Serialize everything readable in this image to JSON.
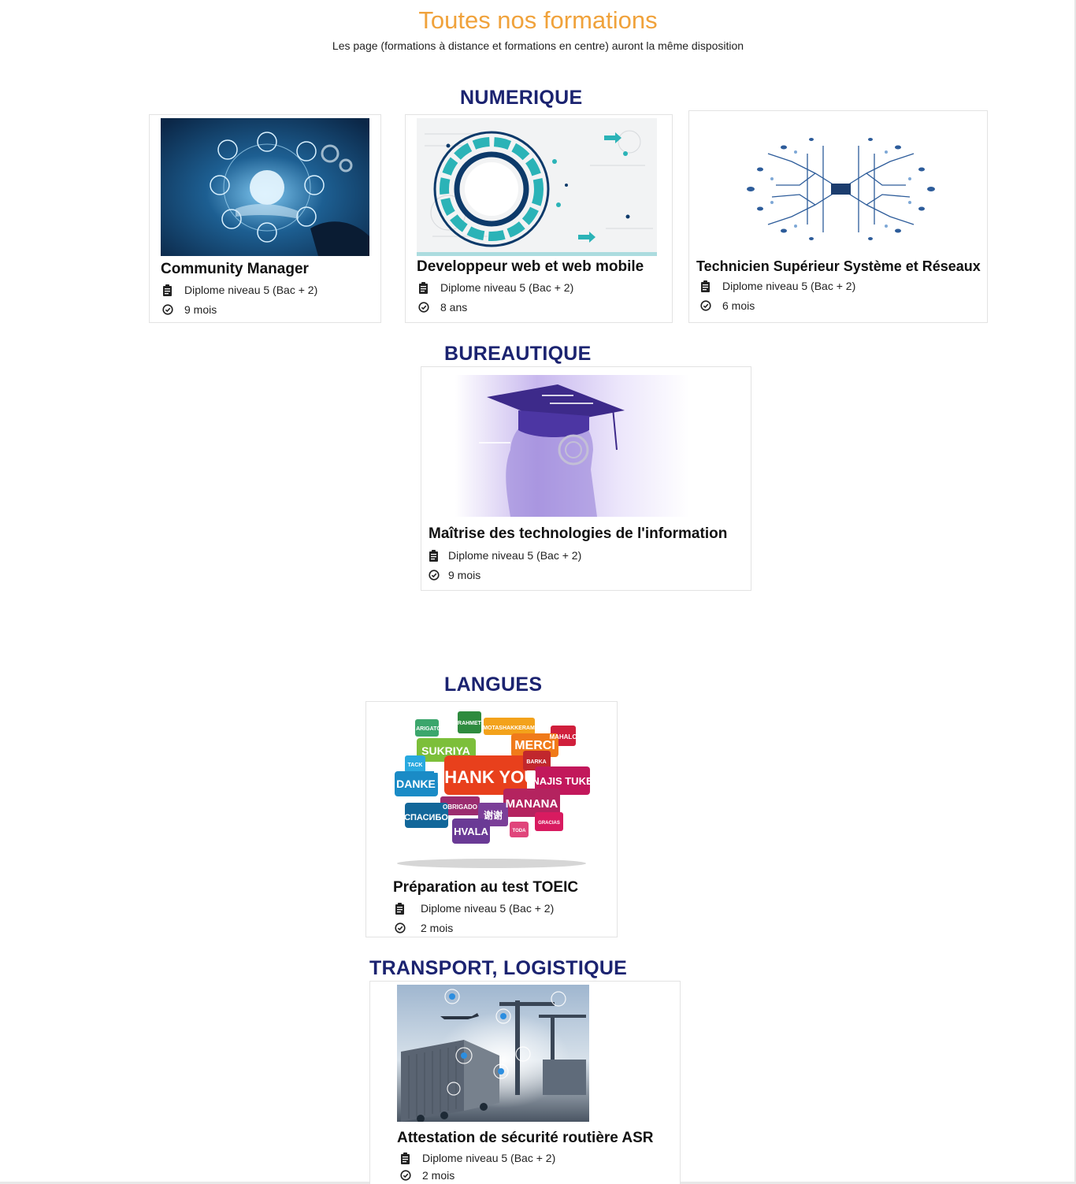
{
  "header": {
    "title": "Toutes nos formations",
    "subtitle": "Les page (formations à distance et formations en centre) auront la même disposition"
  },
  "categories": [
    {
      "name": "NUMERIQUE",
      "courses": [
        {
          "title": "Community Manager",
          "diploma": "Diplome niveau 5 (Bac + 2)",
          "duration": "9 mois",
          "image": "cloud-hand-illustration"
        },
        {
          "title": "Developpeur web et web mobile",
          "diploma": "Diplome niveau 5 (Bac + 2)",
          "duration": "8 ans",
          "image": "tech-circle-illustration"
        },
        {
          "title": "Technicien Supérieur Système et Réseaux",
          "diploma": "Diplome niveau 5 (Bac + 2)",
          "duration": "6 mois",
          "image": "circuit-brain-illustration"
        }
      ]
    },
    {
      "name": "BUREAUTIQUE",
      "courses": [
        {
          "title": "Maîtrise des technologies de l'information",
          "diploma": "Diplome niveau 5 (Bac + 2)",
          "duration": "9 mois",
          "image": "graduate-head-illustration"
        }
      ]
    },
    {
      "name": "LANGUES",
      "courses": [
        {
          "title": "Préparation au test TOEIC",
          "diploma": "Diplome niveau 5 (Bac + 2)",
          "duration": "2 mois",
          "image": "thank-you-speech-bubbles"
        }
      ]
    },
    {
      "name": "TRANSPORT, LOGISTIQUE",
      "courses": [
        {
          "title": "Attestation de sécurité routière ASR",
          "diploma": "Diplome niveau 5 (Bac + 2)",
          "duration": "2 mois",
          "image": "logistics-port-illustration"
        }
      ]
    }
  ],
  "bubbles": {
    "thank_you": "THANK YOU",
    "sukriya": "SUKRIYA",
    "merci": "MERCI",
    "danke": "DANKE",
    "najis_tuke": "NAJIS TUKE",
    "manana": "MANANA",
    "spasibo": "СПАСИБО",
    "hvala": "HVALA",
    "rahmet": "RAHMET",
    "arigato": "ARIGATÓ",
    "mahalo": "MAHALO",
    "tack": "TACK",
    "obrigado": "OBRIGADO",
    "xiexie": "谢谢",
    "toda": "TODA",
    "gracias": "GRACIAS",
    "motashakkeram": "MOTASHAKKERAM",
    "barka": "BARKA",
    "tak": "TAK"
  },
  "icons": {
    "diploma": "clipboard-icon",
    "duration": "clock-icon"
  },
  "colors": {
    "title": "#f0a23b",
    "category": "#1b2370"
  }
}
